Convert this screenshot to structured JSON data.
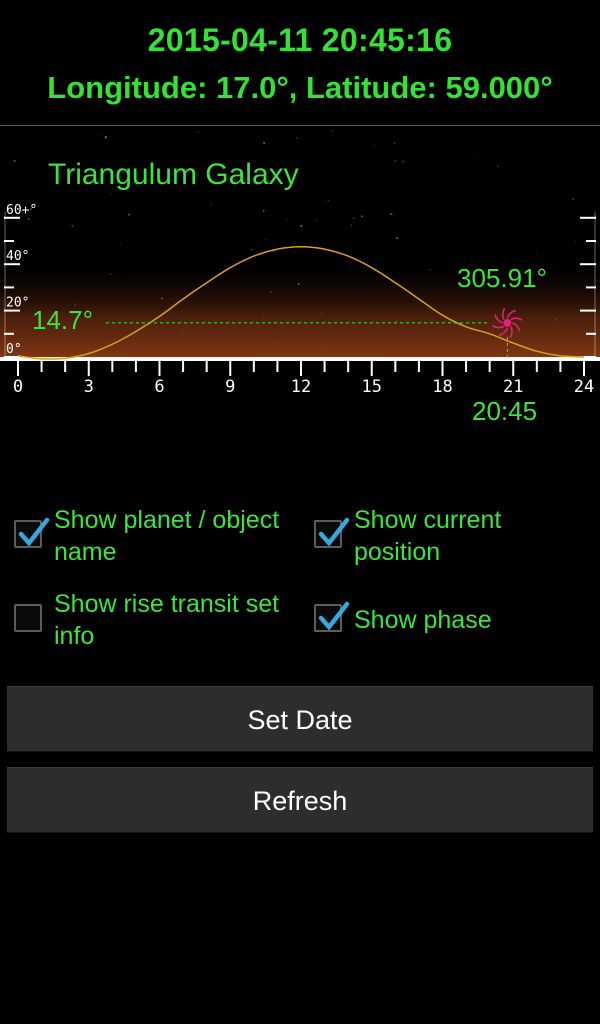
{
  "header": {
    "datetime": "2015-04-11 20:45:16",
    "location": "Longitude: 17.0°, Latitude: 59.000°"
  },
  "chart_data": {
    "type": "line",
    "title": "Triangulum Galaxy",
    "xlabel": "",
    "ylabel": "",
    "x_ticks": [
      "0",
      "3",
      "6",
      "9",
      "12",
      "15",
      "18",
      "21",
      "24"
    ],
    "y_ticks": [
      "60+°",
      "40°",
      "20°",
      "0°"
    ],
    "xlim": [
      0,
      24
    ],
    "series": [
      {
        "x": [
          0,
          1,
          2,
          3,
          4,
          5,
          6,
          7,
          8,
          9,
          10,
          11,
          12,
          13,
          14,
          15,
          16,
          17,
          18,
          19,
          20,
          21,
          22,
          23,
          24
        ],
        "y": [
          0.5,
          -0.8,
          -0.5,
          1.5,
          5.5,
          11,
          17.5,
          25,
          32,
          38.5,
          43.5,
          46.5,
          47.5,
          46.5,
          43.5,
          38.5,
          32,
          25,
          18,
          13,
          10,
          6,
          2.5,
          0.5,
          0
        ]
      }
    ],
    "current": {
      "time_label": "20:45",
      "altitude_label": "14.7°",
      "azimuth_label": "305.91°",
      "time_hours": 20.75,
      "altitude": 14.7
    },
    "colors": {
      "curve": "#d6a019",
      "text": "#3de43d",
      "marker": "#e0207a"
    }
  },
  "options": [
    {
      "label_line1": "Show planet / object",
      "label_line2": "name",
      "checked": true
    },
    {
      "label_line1": "Show current",
      "label_line2": "position",
      "checked": true
    },
    {
      "label_line1": "Show rise transit set",
      "label_line2": "info",
      "checked": false
    },
    {
      "label_line1": "Show phase",
      "label_line2": "",
      "checked": true
    }
  ],
  "buttons": {
    "set_date": "Set Date",
    "refresh": "Refresh"
  }
}
